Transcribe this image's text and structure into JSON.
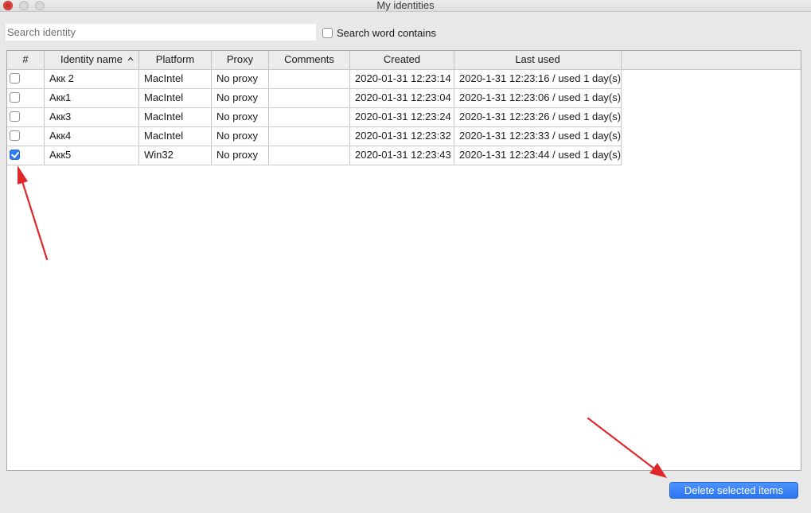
{
  "window": {
    "title": "My identities"
  },
  "search": {
    "placeholder": "Search identity",
    "value": "",
    "contains_label": "Search word contains",
    "contains_checked": false
  },
  "table": {
    "columns": [
      "#",
      "Identity name",
      "Platform",
      "Proxy",
      "Comments",
      "Created",
      "Last used"
    ],
    "sorted_column": "Identity name",
    "sort_direction": "ascending",
    "rows": [
      {
        "checked": false,
        "name": "Акк 2",
        "platform": "MacIntel",
        "proxy": "No proxy",
        "comments": "",
        "created": "2020-01-31 12:23:14",
        "last_used": "2020-1-31 12:23:16 / used 1 day(s)"
      },
      {
        "checked": false,
        "name": "Акк1",
        "platform": "MacIntel",
        "proxy": "No proxy",
        "comments": "",
        "created": "2020-01-31 12:23:04",
        "last_used": "2020-1-31 12:23:06 / used 1 day(s)"
      },
      {
        "checked": false,
        "name": "Акк3",
        "platform": "MacIntel",
        "proxy": "No proxy",
        "comments": "",
        "created": "2020-01-31 12:23:24",
        "last_used": "2020-1-31 12:23:26 / used 1 day(s)"
      },
      {
        "checked": false,
        "name": "Акк4",
        "platform": "MacIntel",
        "proxy": "No proxy",
        "comments": "",
        "created": "2020-01-31 12:23:32",
        "last_used": "2020-1-31 12:23:33 / used 1 day(s)"
      },
      {
        "checked": true,
        "name": "Акк5",
        "platform": "Win32",
        "proxy": "No proxy",
        "comments": "",
        "created": "2020-01-31 12:23:43",
        "last_used": "2020-1-31 12:23:44 / used 1 day(s)"
      }
    ]
  },
  "actions": {
    "delete_label": "Delete selected items"
  },
  "colors": {
    "accent": "#2f7cf6",
    "annotation_arrow": "#e0282a"
  }
}
